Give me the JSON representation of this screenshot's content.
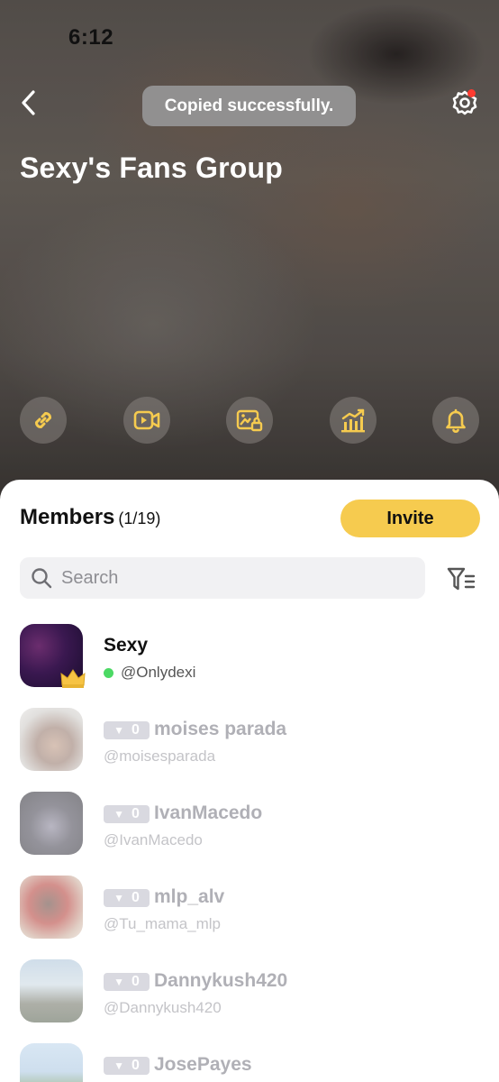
{
  "status_bar": {
    "time": "6:12"
  },
  "header": {
    "toast": "Copied successfully.",
    "group_title": "Sexy's Fans Group",
    "actions": [
      {
        "icon": "link-icon"
      },
      {
        "icon": "video-icon"
      },
      {
        "icon": "photo-lock-icon"
      },
      {
        "icon": "chart-icon"
      },
      {
        "icon": "bell-icon"
      }
    ]
  },
  "members": {
    "title": "Members",
    "count": "(1/19)",
    "invite_label": "Invite",
    "search_placeholder": "Search",
    "list": [
      {
        "name": "Sexy",
        "handle": "@Onlydexi",
        "online": true,
        "owner": true
      },
      {
        "name": "moises parada",
        "handle": "@moisesparada",
        "level": "0"
      },
      {
        "name": "IvanMacedo",
        "handle": "@IvanMacedo",
        "level": "0"
      },
      {
        "name": "mlp_alv",
        "handle": "@Tu_mama_mlp",
        "level": "0"
      },
      {
        "name": "Dannykush420",
        "handle": "@Dannykush420",
        "level": "0"
      },
      {
        "name": "JosePayes",
        "handle": "",
        "level": "0"
      }
    ]
  },
  "colors": {
    "accent": "#f6cb4f",
    "online": "#4cd964",
    "notification": "#ff3b30"
  }
}
